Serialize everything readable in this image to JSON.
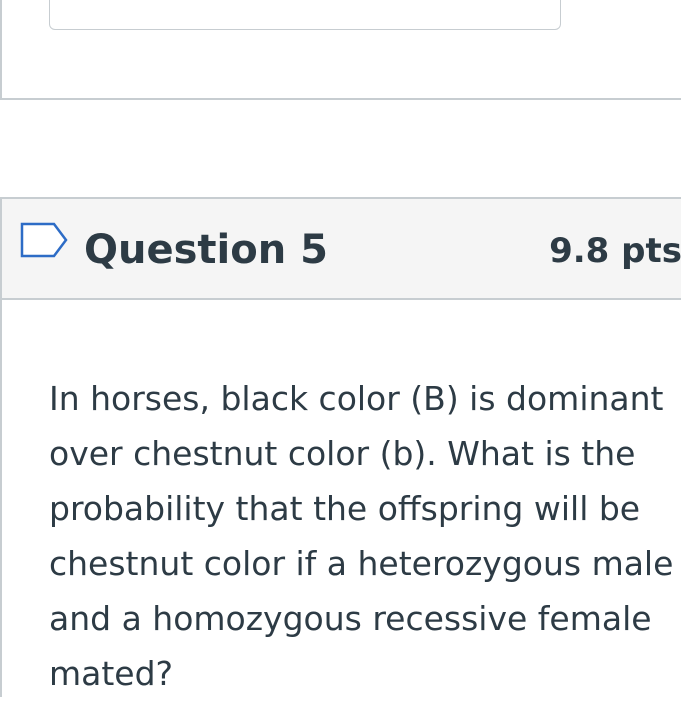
{
  "previous_question": {
    "answer_value": ""
  },
  "question": {
    "title": "Question 5",
    "points": "9.8 pts",
    "flag_icon": "flag-outline-icon",
    "text": "In horses, black color (B) is dominant over chestnut color (b).  What is the probability that the offspring will be chestnut color if a heterozygous male and a homozygous recessive female mated?"
  },
  "colors": {
    "text": "#2d3b45",
    "border": "#c7cdd1",
    "header_bg": "#f5f5f5",
    "flag_stroke": "#2d6cc6"
  }
}
